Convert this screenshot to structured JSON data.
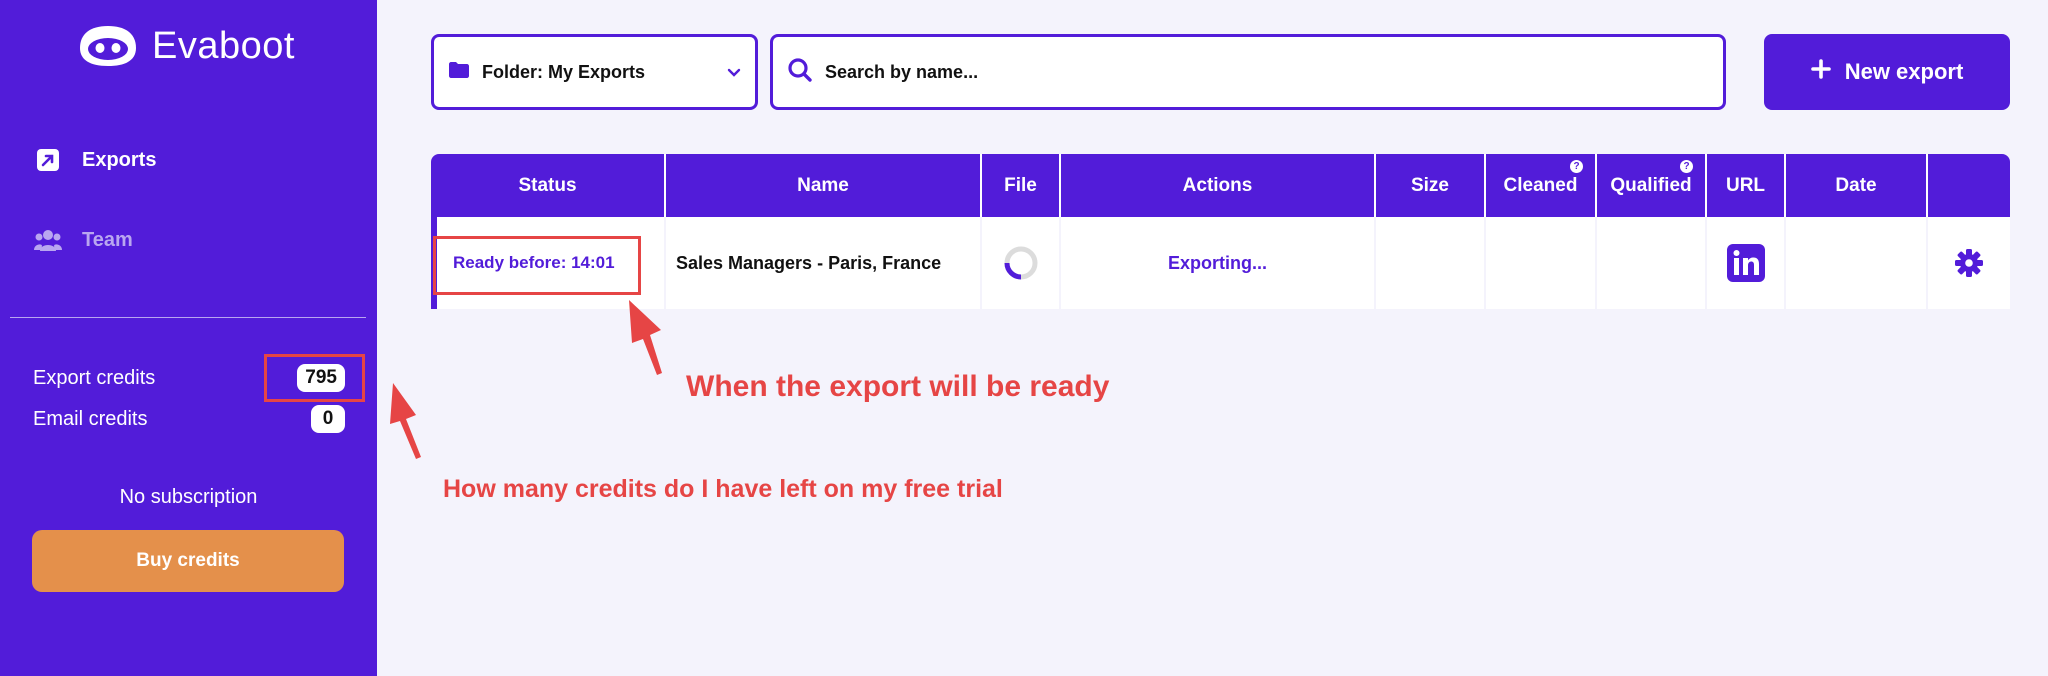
{
  "app": {
    "brand": "Evaboot"
  },
  "sidebar": {
    "nav": [
      {
        "label": "Exports",
        "icon": "export-icon",
        "active": true
      },
      {
        "label": "Team",
        "icon": "team-icon",
        "active": false
      }
    ],
    "credits": {
      "export_label": "Export credits",
      "export_value": "795",
      "email_label": "Email credits",
      "email_value": "0"
    },
    "subscription": "No subscription",
    "buy_label": "Buy credits"
  },
  "toolbar": {
    "folder_label": "Folder: My Exports",
    "search_placeholder": "Search by name...",
    "new_export_label": "New export"
  },
  "table": {
    "columns": [
      "Status",
      "Name",
      "File",
      "Actions",
      "Size",
      "Cleaned",
      "Qualified",
      "URL",
      "Date",
      ""
    ],
    "rows": [
      {
        "status": "Ready before: 14:01",
        "name": "Sales Managers - Paris, France",
        "file": "loading-spinner",
        "action": "Exporting...",
        "size": "",
        "cleaned": "",
        "qualified": "",
        "url": "linkedin-icon",
        "date": ""
      }
    ]
  },
  "annotations": {
    "ready_note": "When the export will be ready",
    "credits_note": "How many credits do I have left on my free trial"
  },
  "colors": {
    "brand": "#521cd9",
    "accent": "#e4904b",
    "annotation": "#e64545",
    "background": "#f4f3fc"
  }
}
